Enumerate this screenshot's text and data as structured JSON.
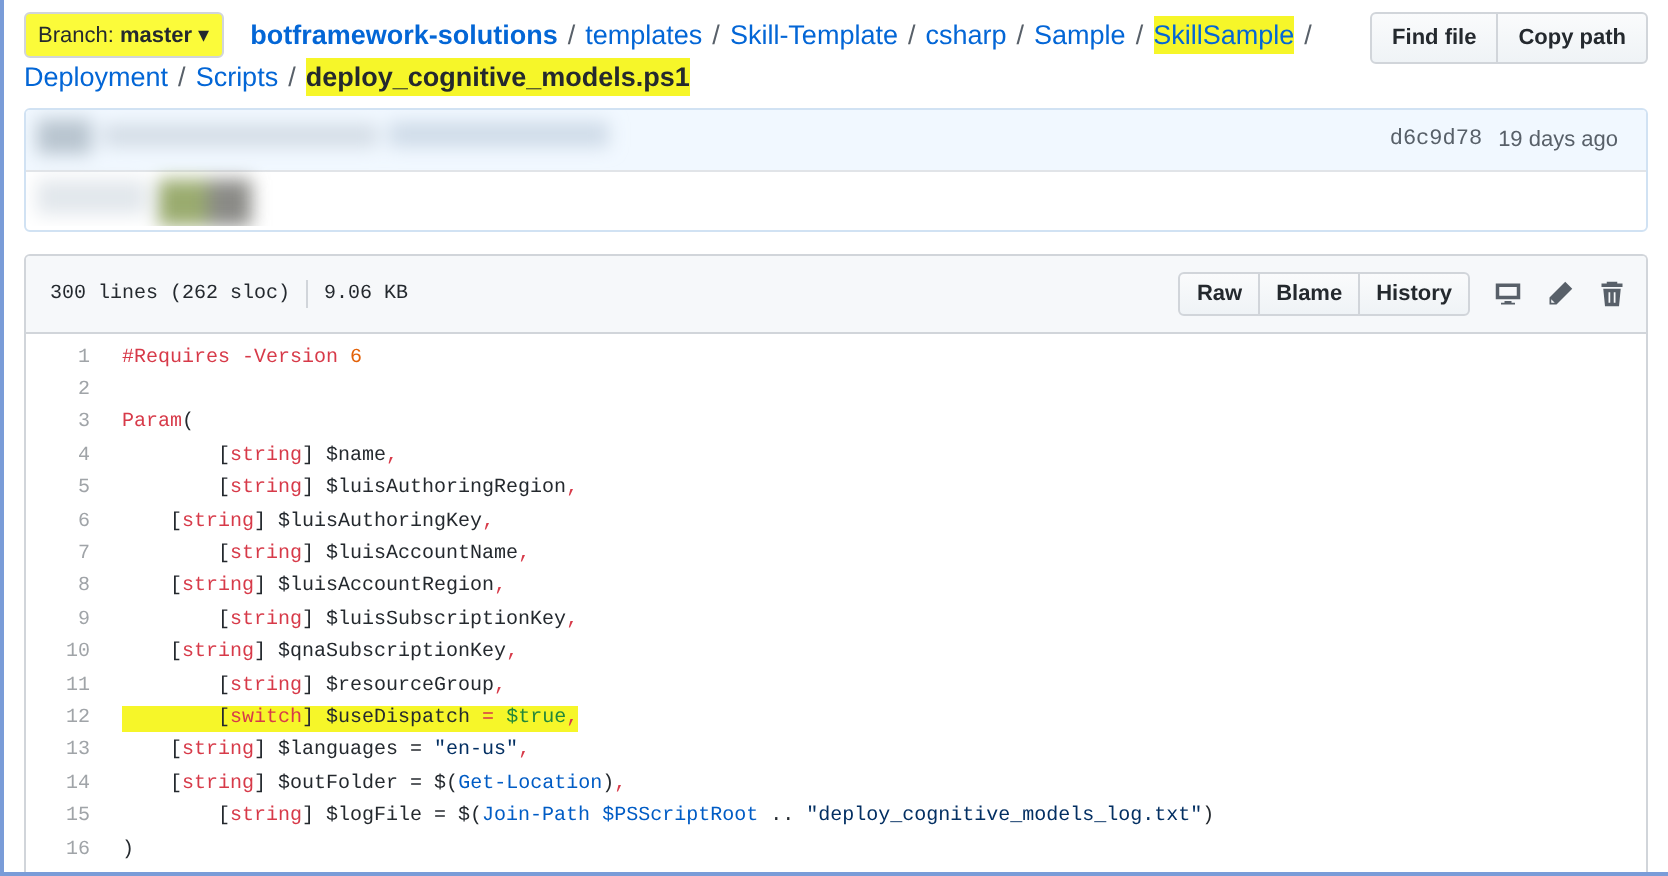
{
  "branch": {
    "label": "Branch: **master**",
    "highlighted": true,
    "caret": "▾"
  },
  "breadcrumb": [
    {
      "kind": "root",
      "text": "botframework-solutions",
      "highlighted": false
    },
    {
      "kind": "sep",
      "text": "/",
      "highlighted": false
    },
    {
      "kind": "link",
      "text": "templates",
      "highlighted": false
    },
    {
      "kind": "sep",
      "text": "/",
      "highlighted": false
    },
    {
      "kind": "link",
      "text": "Skill-Template",
      "highlighted": false
    },
    {
      "kind": "sep",
      "text": "/",
      "highlighted": false
    },
    {
      "kind": "link",
      "text": "csharp",
      "highlighted": false
    },
    {
      "kind": "sep",
      "text": "/",
      "highlighted": false
    },
    {
      "kind": "link",
      "text": "Sample",
      "highlighted": false
    },
    {
      "kind": "sep",
      "text": "/",
      "highlighted": false
    },
    {
      "kind": "link",
      "text": "SkillSample",
      "highlighted": true
    },
    {
      "kind": "sep",
      "text": "/",
      "highlighted": false
    },
    {
      "kind": "link",
      "text": "Deployment",
      "highlighted": false
    },
    {
      "kind": "sep",
      "text": "/",
      "highlighted": false
    },
    {
      "kind": "link",
      "text": "Scripts",
      "highlighted": false
    },
    {
      "kind": "sep",
      "text": "/",
      "highlighted": false
    },
    {
      "kind": "current",
      "text": "deploy_cognitive_models.ps1",
      "highlighted": true
    }
  ],
  "path_buttons": [
    "Find file",
    "Copy path"
  ],
  "commit": {
    "sha": "d6c9d78",
    "age": "19 days ago"
  },
  "file_info": {
    "lines": "300 lines (262 sloc)",
    "size": "9.06 KB"
  },
  "file_buttons": [
    "Raw",
    "Blame",
    "History"
  ],
  "code": [
    {
      "number": "1",
      "highlighted": false,
      "tokens": [
        {
          "kind": "kw",
          "text": "#Requires -Version "
        },
        {
          "kind": "num",
          "text": "6"
        }
      ]
    },
    {
      "number": "2",
      "highlighted": false
    },
    {
      "number": "3",
      "highlighted": false,
      "tokens": [
        {
          "kind": "kw",
          "text": "Param"
        },
        {
          "kind": "plain",
          "text": "("
        }
      ]
    },
    {
      "number": "4",
      "highlighted": false,
      "tokens": [
        {
          "kind": "plain",
          "text": "        ["
        },
        {
          "kind": "kw",
          "text": "string"
        },
        {
          "kind": "plain",
          "text": "] $name"
        },
        {
          "kind": "op",
          "text": ","
        }
      ]
    },
    {
      "number": "5",
      "highlighted": false,
      "tokens": [
        {
          "kind": "plain",
          "text": "        ["
        },
        {
          "kind": "kw",
          "text": "string"
        },
        {
          "kind": "plain",
          "text": "] $luisAuthoringRegion"
        },
        {
          "kind": "op",
          "text": ","
        }
      ]
    },
    {
      "number": "6",
      "highlighted": false,
      "tokens": [
        {
          "kind": "plain",
          "text": "    ["
        },
        {
          "kind": "kw",
          "text": "string"
        },
        {
          "kind": "plain",
          "text": "] $luisAuthoringKey"
        },
        {
          "kind": "op",
          "text": ","
        }
      ]
    },
    {
      "number": "7",
      "highlighted": false,
      "tokens": [
        {
          "kind": "plain",
          "text": "        ["
        },
        {
          "kind": "kw",
          "text": "string"
        },
        {
          "kind": "plain",
          "text": "] $luisAccountName"
        },
        {
          "kind": "op",
          "text": ","
        }
      ]
    },
    {
      "number": "8",
      "highlighted": false,
      "tokens": [
        {
          "kind": "plain",
          "text": "    ["
        },
        {
          "kind": "kw",
          "text": "string"
        },
        {
          "kind": "plain",
          "text": "] $luisAccountRegion"
        },
        {
          "kind": "op",
          "text": ","
        }
      ]
    },
    {
      "number": "9",
      "highlighted": false,
      "tokens": [
        {
          "kind": "plain",
          "text": "        ["
        },
        {
          "kind": "kw",
          "text": "string"
        },
        {
          "kind": "plain",
          "text": "] $luisSubscriptionKey"
        },
        {
          "kind": "op",
          "text": ","
        }
      ]
    },
    {
      "number": "10",
      "highlighted": false,
      "tokens": [
        {
          "kind": "plain",
          "text": "    ["
        },
        {
          "kind": "kw",
          "text": "string"
        },
        {
          "kind": "plain",
          "text": "] $qnaSubscriptionKey"
        },
        {
          "kind": "op",
          "text": ","
        }
      ]
    },
    {
      "number": "11",
      "highlighted": false,
      "tokens": [
        {
          "kind": "plain",
          "text": "        ["
        },
        {
          "kind": "kw",
          "text": "string"
        },
        {
          "kind": "plain",
          "text": "] $resourceGroup"
        },
        {
          "kind": "op",
          "text": ","
        }
      ]
    },
    {
      "number": "12",
      "highlighted": true,
      "tokens": [
        {
          "kind": "plain",
          "text": "        ["
        },
        {
          "kind": "kw",
          "text": "switch"
        },
        {
          "kind": "plain",
          "text": "] $useDispatch "
        },
        {
          "kind": "op",
          "text": "="
        },
        {
          "kind": "bool",
          "text": " $true"
        },
        {
          "kind": "op",
          "text": ","
        }
      ]
    },
    {
      "number": "13",
      "highlighted": false,
      "tokens": [
        {
          "kind": "plain",
          "text": "    ["
        },
        {
          "kind": "kw",
          "text": "string"
        },
        {
          "kind": "plain",
          "text": "] $languages = "
        },
        {
          "kind": "str",
          "text": "\"en-us\""
        },
        {
          "kind": "op",
          "text": ","
        }
      ]
    },
    {
      "number": "14",
      "highlighted": false,
      "tokens": [
        {
          "kind": "plain",
          "text": "    ["
        },
        {
          "kind": "kw",
          "text": "string"
        },
        {
          "kind": "plain",
          "text": "] $outFolder = $("
        },
        {
          "kind": "fn",
          "text": "Get-Location"
        },
        {
          "kind": "plain",
          "text": ")"
        },
        {
          "kind": "op",
          "text": ","
        }
      ]
    },
    {
      "number": "15",
      "highlighted": false,
      "tokens": [
        {
          "kind": "plain",
          "text": "        ["
        },
        {
          "kind": "kw",
          "text": "string"
        },
        {
          "kind": "plain",
          "text": "] $logFile = $("
        },
        {
          "kind": "fn",
          "text": "Join-Path"
        },
        {
          "kind": "fn",
          "text": " $PSScriptRoot"
        },
        {
          "kind": "plain",
          "text": " .. "
        },
        {
          "kind": "str",
          "text": "\"deploy_cognitive_models_log.txt\""
        },
        {
          "kind": "plain",
          "text": ")"
        }
      ]
    },
    {
      "number": "16",
      "highlighted": false,
      "tokens": [
        {
          "kind": "plain",
          "text": ")"
        }
      ]
    }
  ]
}
